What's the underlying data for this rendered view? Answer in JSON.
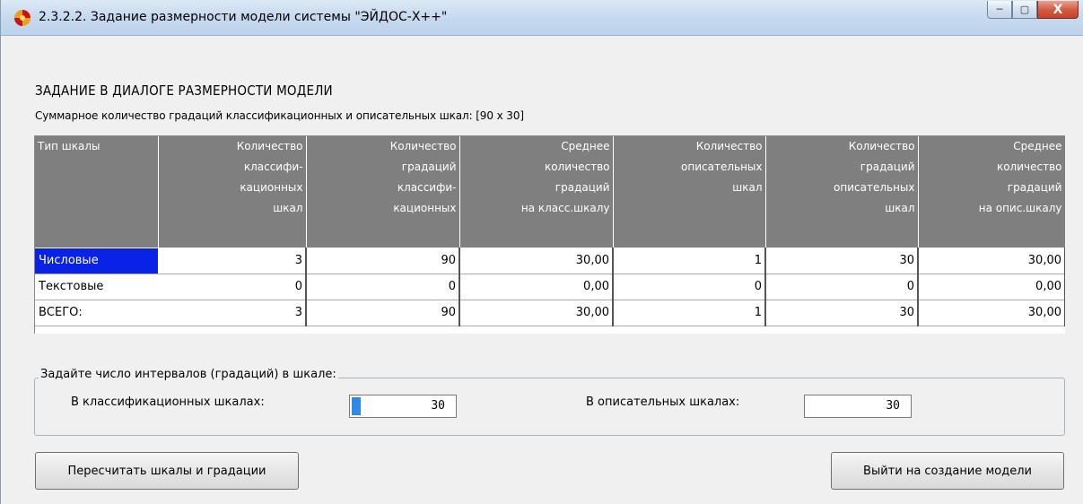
{
  "window": {
    "title": "2.3.2.2. Задание размерности модели системы \"ЭЙДОС-Х++\"",
    "controls": {
      "minimize": "─",
      "maximize": "▢",
      "close": "X"
    }
  },
  "heading": "ЗАДАНИЕ В ДИАЛОГЕ РАЗМЕРНОСТИ МОДЕЛИ",
  "subheading": "Суммарное количество градаций классификационных и описательных шкал: [90 x 30]",
  "table": {
    "headers": [
      [
        "Тип шкалы"
      ],
      [
        "Количество",
        "классифи-",
        "кационных",
        "шкал"
      ],
      [
        "Количество",
        "градаций",
        "классифи-",
        "кационных"
      ],
      [
        "Среднее",
        "количество",
        "градаций",
        "на класс.шкалу"
      ],
      [
        "Количество",
        "описательных",
        "шкал"
      ],
      [
        "Количество",
        "градаций",
        "описательных",
        "шкал"
      ],
      [
        "Среднее",
        "количество",
        "градаций",
        "на опис.шкалу"
      ]
    ],
    "rows": [
      [
        "Числовые",
        "3",
        "90",
        "30,00",
        "1",
        "30",
        "30,00"
      ],
      [
        "Текстовые",
        "0",
        "0",
        "0,00",
        "0",
        "0",
        "0,00"
      ],
      [
        "ВСЕГО:",
        "3",
        "90",
        "30,00",
        "1",
        "30",
        "30,00"
      ]
    ],
    "selected_row": 0
  },
  "intervals": {
    "group_label": "Задайте число интервалов (градаций) в шкале:",
    "class_label": "В классификационных шкалах:",
    "class_value": "30",
    "desc_label": "В описательных шкалах:",
    "desc_value": "30"
  },
  "buttons": {
    "recalc": "Пересчитать шкалы и градации",
    "exit": "Выйти на создание модели"
  }
}
